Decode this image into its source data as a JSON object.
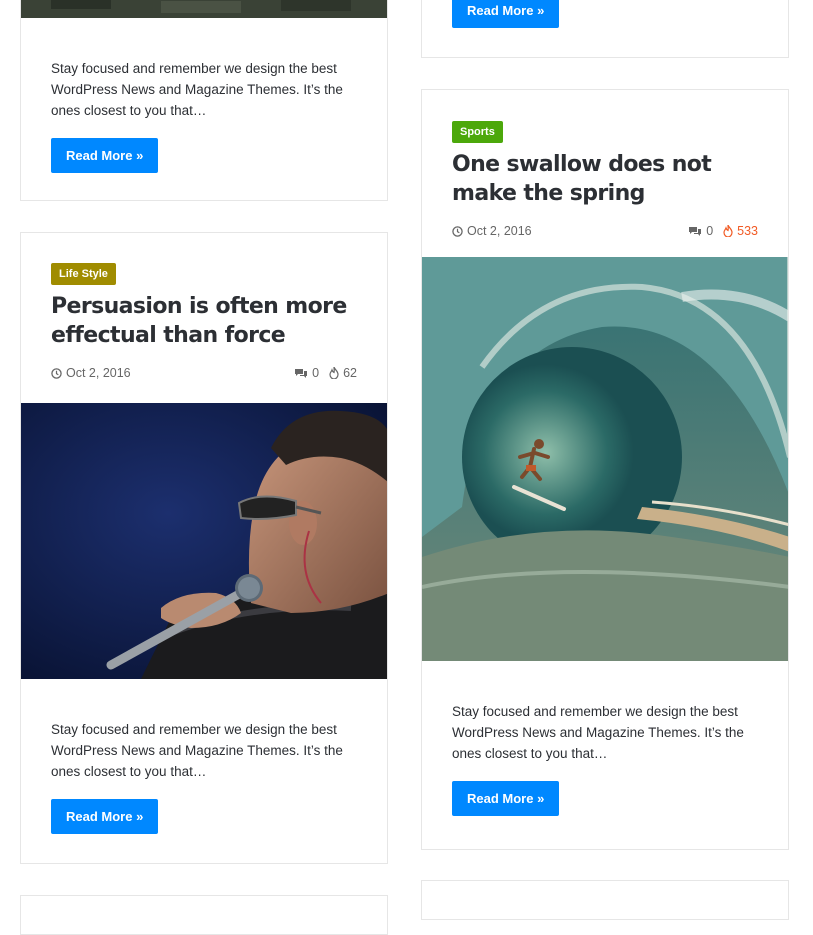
{
  "left_column": {
    "top_card": {
      "excerpt": "Stay focused and remember we design the best WordPress News and Magazine Themes. It’s the ones closest to you that…",
      "read_more": "Read More »"
    },
    "post_card": {
      "category": "Life Style",
      "category_color": "#a08c00",
      "title": "Persuasion is often more effectual than force",
      "date": "Oct 2, 2016",
      "comments": "0",
      "views": "62",
      "excerpt": "Stay focused and remember we design the best WordPress News and Magazine Themes. It’s the ones closest to you that…",
      "read_more": "Read More »"
    }
  },
  "right_column": {
    "top_card": {
      "read_more": "Read More »"
    },
    "post_card": {
      "category": "Sports",
      "category_color": "#4ca80b",
      "title": "One swallow does not make the spring",
      "date": "Oct 2, 2016",
      "comments": "0",
      "views": "533",
      "excerpt": "Stay focused and remember we design the best WordPress News and Magazine Themes. It’s the ones closest to you that…",
      "read_more": "Read More »"
    }
  },
  "theme": {
    "accent": "#0088ff",
    "hot_color": "#f15a24"
  }
}
